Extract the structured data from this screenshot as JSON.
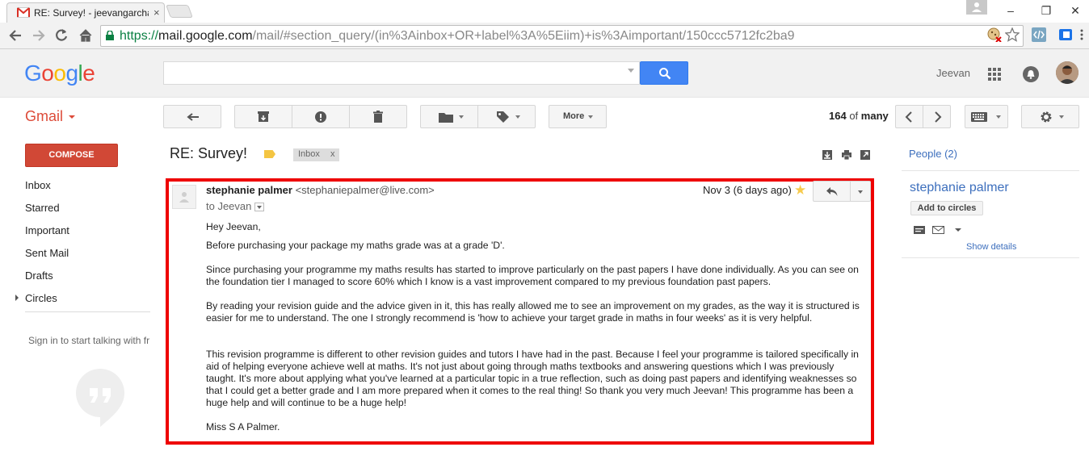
{
  "browser": {
    "tab_title": "RE: Survey! - jeevangarcha",
    "tab_close": "×",
    "url_https": "https",
    "url_host_prefix": "://",
    "url_host": "mail.google.com",
    "url_path": "/mail/#section_query/(in%3Ainbox+OR+label%3A%5Eiim)+is%3Aimportant/150ccc5712fc2ba9",
    "window_minimize": "–",
    "window_maximize": "❐",
    "window_close": "✕"
  },
  "header": {
    "logo_letters": [
      "G",
      "o",
      "o",
      "g",
      "l",
      "e"
    ],
    "logo_colors": [
      "#4285f4",
      "#ea4335",
      "#fbbc05",
      "#4285f4",
      "#34a853",
      "#ea4335"
    ],
    "search_value": "",
    "user_name": "Jeevan"
  },
  "sidebar": {
    "product": "Gmail",
    "compose_label": "COMPOSE",
    "items": [
      {
        "label": "Inbox"
      },
      {
        "label": "Starred"
      },
      {
        "label": "Important"
      },
      {
        "label": "Sent Mail"
      },
      {
        "label": "Drafts"
      },
      {
        "label": "Circles"
      }
    ],
    "hangouts_text": "Sign in to start talking with fr"
  },
  "toolbar": {
    "more_label": "More",
    "count": "164",
    "of": "of",
    "total": "many"
  },
  "thread": {
    "subject": "RE: Survey!",
    "chip_label": "Inbox",
    "chip_close": "x"
  },
  "right_panel": {
    "people": "People (2)",
    "person_name": "stephanie palmer",
    "add_circles": "Add to circles",
    "show_details": "Show details"
  },
  "message": {
    "sender_name": "stephanie palmer",
    "sender_email": "<stephaniepalmer@live.com>",
    "to": "to Jeevan",
    "date": "Nov 3 (6 days ago)",
    "star": "★",
    "paragraphs": [
      "Hey Jeevan,",
      "Before purchasing your package my maths grade was at a grade 'D'.",
      "Since purchasing your programme my maths results has started to improve particularly on the past papers I have done individually. As you can see on the foundation tier I managed to score 60% which I know is a vast improvement compared to my previous foundation past papers.",
      "By reading your revision guide and the advice given in it, this has really allowed me to see an improvement on my grades, as the way it is structured is easier for me to understand. The one I strongly recommend is 'how to achieve your target grade in maths in four weeks' as it is very helpful.",
      "This revision programme is different to other revision guides and tutors I have had in the past. Because I feel your programme is tailored specifically in aid of helping everyone achieve well at maths. It's not just about going through maths textbooks and answering questions which I was previously taught. It's more about applying what you've learned at a particular topic in a true reflection, such as doing past papers and identifying weaknesses so that I could get a better grade and I am more prepared when it comes to the real thing! So thank you very much Jeevan! This programme has been a huge help and will continue to be a huge help!",
      "Miss S A Palmer."
    ]
  },
  "colors": {
    "accent_red": "#dd4b39",
    "link_blue": "#3d6fbd",
    "highlight_frame": "#ee0000",
    "search_blue": "#4285f4"
  }
}
